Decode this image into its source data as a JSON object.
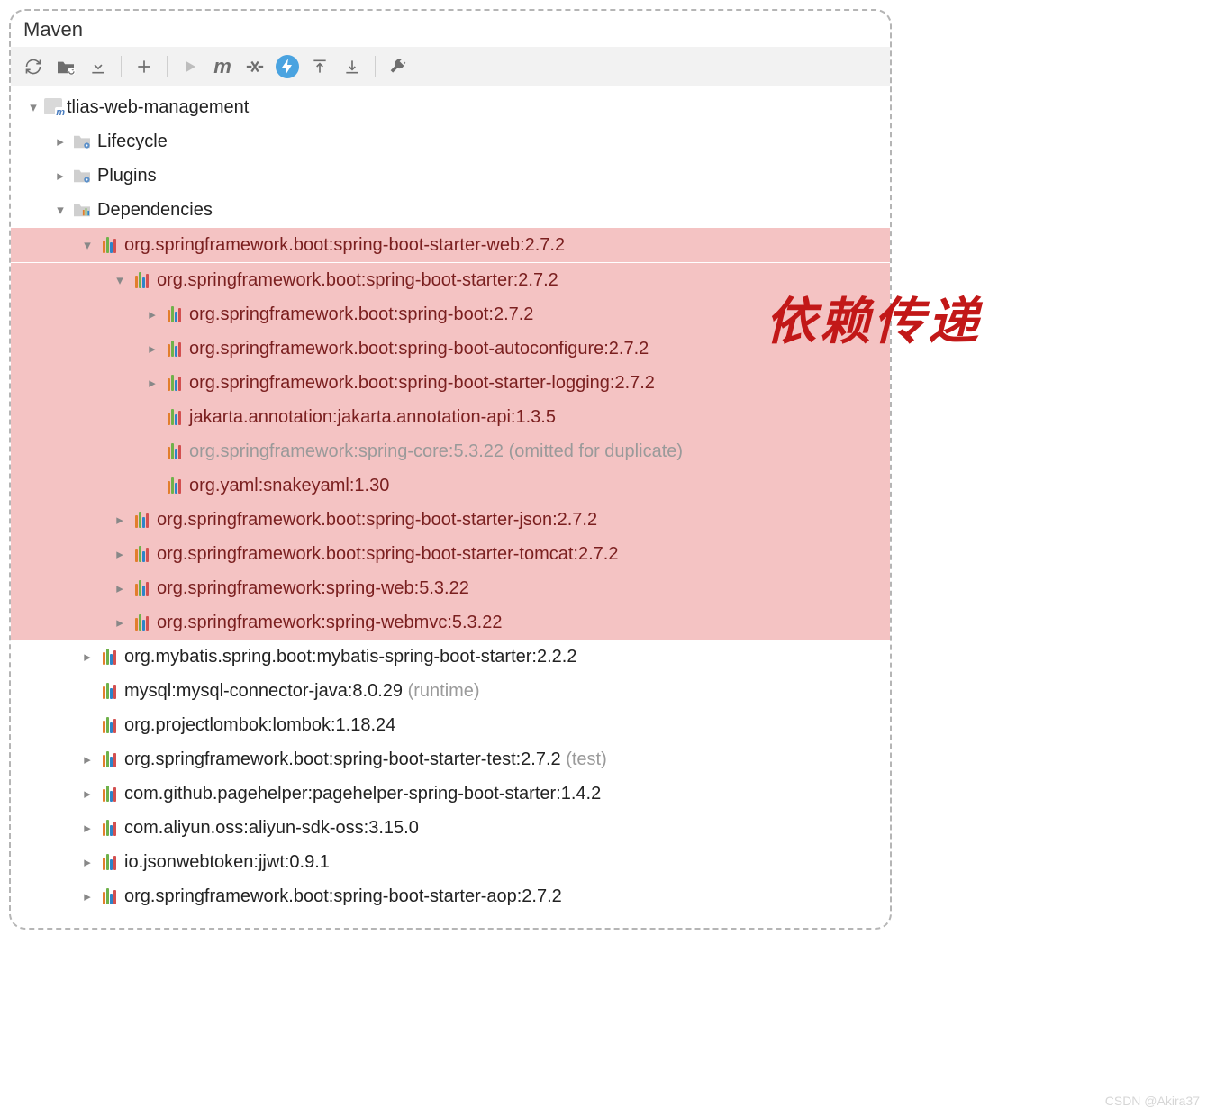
{
  "panel": {
    "title": "Maven"
  },
  "toolbar": {
    "icons": [
      "refresh",
      "folder-sync",
      "download",
      "plus",
      "play",
      "m",
      "skip",
      "bolt",
      "expand",
      "collapse",
      "wrench"
    ]
  },
  "annotation": "依赖传递",
  "watermark": "CSDN @Akira37",
  "tree": {
    "root": {
      "label": "tlias-web-management",
      "children": [
        {
          "label": "Lifecycle"
        },
        {
          "label": "Plugins"
        },
        {
          "label": "Dependencies"
        }
      ]
    },
    "highlighted": {
      "root": "org.springframework.boot:spring-boot-starter-web:2.7.2",
      "level3": {
        "root": "org.springframework.boot:spring-boot-starter:2.7.2",
        "children": [
          {
            "label": "org.springframework.boot:spring-boot:2.7.2",
            "expandable": true
          },
          {
            "label": "org.springframework.boot:spring-boot-autoconfigure:2.7.2",
            "expandable": true
          },
          {
            "label": "org.springframework.boot:spring-boot-starter-logging:2.7.2",
            "expandable": true
          },
          {
            "label": "jakarta.annotation:jakarta.annotation-api:1.3.5",
            "expandable": false
          },
          {
            "label": "org.springframework:spring-core:5.3.22",
            "suffix": "(omitted for duplicate)",
            "gray": true,
            "expandable": false
          },
          {
            "label": "org.yaml:snakeyaml:1.30",
            "expandable": false
          }
        ]
      },
      "siblings": [
        "org.springframework.boot:spring-boot-starter-json:2.7.2",
        "org.springframework.boot:spring-boot-starter-tomcat:2.7.2",
        "org.springframework:spring-web:5.3.22",
        "org.springframework:spring-webmvc:5.3.22"
      ]
    },
    "rest": [
      {
        "label": "org.mybatis.spring.boot:mybatis-spring-boot-starter:2.2.2",
        "expandable": true
      },
      {
        "label": "mysql:mysql-connector-java:8.0.29",
        "suffix": "(runtime)",
        "expandable": false
      },
      {
        "label": "org.projectlombok:lombok:1.18.24",
        "expandable": false
      },
      {
        "label": "org.springframework.boot:spring-boot-starter-test:2.7.2",
        "suffix": "(test)",
        "expandable": true
      },
      {
        "label": "com.github.pagehelper:pagehelper-spring-boot-starter:1.4.2",
        "expandable": true
      },
      {
        "label": "com.aliyun.oss:aliyun-sdk-oss:3.15.0",
        "expandable": true
      },
      {
        "label": "io.jsonwebtoken:jjwt:0.9.1",
        "expandable": true
      },
      {
        "label": "org.springframework.boot:spring-boot-starter-aop:2.7.2",
        "expandable": true
      }
    ]
  }
}
